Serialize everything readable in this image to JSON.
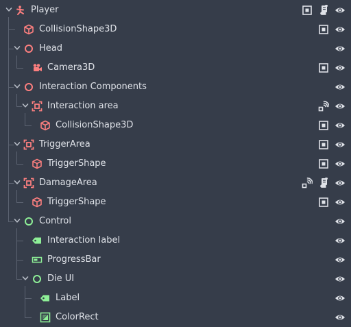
{
  "colors": {
    "background": "#363d4a",
    "node3d_icon": "#fc7f7f",
    "control_icon": "#8eef97",
    "text": "#dfe2e8",
    "button_icon": "#dfe2e8",
    "guide_line": "#5d6472"
  },
  "scene_tree": {
    "nodes": [
      {
        "label": "Player",
        "icon": "character-body-icon",
        "depth": 0,
        "expanded": true,
        "buttons": [
          "group-icon",
          "script-icon",
          "visibility-icon"
        ]
      },
      {
        "label": "CollisionShape3D",
        "icon": "collision-shape-icon",
        "depth": 1,
        "expanded": null,
        "buttons": [
          "group-icon",
          "visibility-icon"
        ]
      },
      {
        "label": "Head",
        "icon": "node3d-icon",
        "depth": 1,
        "expanded": true,
        "buttons": [
          "visibility-icon"
        ]
      },
      {
        "label": "Camera3D",
        "icon": "camera-icon",
        "depth": 2,
        "expanded": null,
        "buttons": [
          "group-icon",
          "visibility-icon"
        ]
      },
      {
        "label": "Interaction Components",
        "icon": "node3d-icon",
        "depth": 1,
        "expanded": true,
        "buttons": [
          "visibility-icon"
        ]
      },
      {
        "label": "Interaction area",
        "icon": "area-icon",
        "depth": 2,
        "expanded": true,
        "buttons": [
          "signal-icon",
          "visibility-icon"
        ]
      },
      {
        "label": "CollisionShape3D",
        "icon": "collision-shape-icon",
        "depth": 3,
        "expanded": null,
        "buttons": [
          "group-icon",
          "visibility-icon"
        ]
      },
      {
        "label": "TriggerArea",
        "icon": "area-icon",
        "depth": 1,
        "expanded": true,
        "buttons": [
          "group-icon",
          "visibility-icon"
        ]
      },
      {
        "label": "TriggerShape",
        "icon": "collision-shape-icon",
        "depth": 2,
        "expanded": null,
        "buttons": [
          "group-icon",
          "visibility-icon"
        ]
      },
      {
        "label": "DamageArea",
        "icon": "area-icon",
        "depth": 1,
        "expanded": true,
        "buttons": [
          "signal-icon",
          "script-icon",
          "visibility-icon"
        ]
      },
      {
        "label": "TriggerShape",
        "icon": "collision-shape-icon",
        "depth": 2,
        "expanded": null,
        "buttons": [
          "group-icon",
          "visibility-icon"
        ]
      },
      {
        "label": "Control",
        "icon": "control-icon",
        "depth": 1,
        "expanded": true,
        "buttons": [
          "visibility-icon"
        ]
      },
      {
        "label": "Interaction label",
        "icon": "label-icon",
        "depth": 2,
        "expanded": null,
        "buttons": [
          "visibility-icon"
        ]
      },
      {
        "label": "ProgressBar",
        "icon": "progress-bar-icon",
        "depth": 2,
        "expanded": null,
        "buttons": [
          "visibility-icon"
        ]
      },
      {
        "label": "Die UI",
        "icon": "control-icon",
        "depth": 2,
        "expanded": true,
        "buttons": [
          "visibility-icon"
        ]
      },
      {
        "label": "Label",
        "icon": "label-icon",
        "depth": 3,
        "expanded": null,
        "buttons": [
          "visibility-icon"
        ]
      },
      {
        "label": "ColorRect",
        "icon": "color-rect-icon",
        "depth": 3,
        "expanded": null,
        "buttons": [
          "visibility-icon"
        ]
      }
    ]
  }
}
